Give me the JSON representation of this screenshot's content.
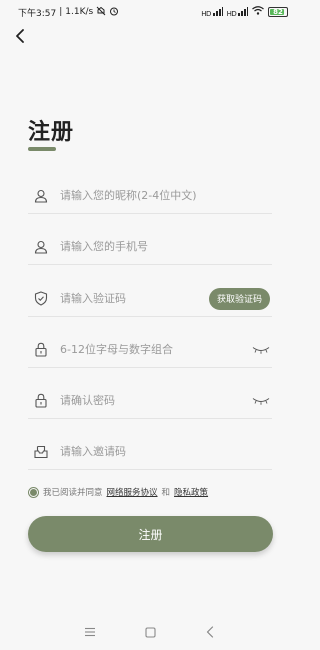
{
  "status_bar": {
    "time": "下午3:57",
    "speed": "1.1K/s",
    "signal1": "HD",
    "signal2": "HD",
    "battery": "82"
  },
  "page": {
    "title": "注册"
  },
  "fields": {
    "nickname": {
      "placeholder": "请输入您的昵称(2-4位中文)",
      "icon": "user-icon"
    },
    "phone": {
      "placeholder": "请输入您的手机号",
      "icon": "user-icon"
    },
    "code": {
      "placeholder": "请输入验证码",
      "icon": "shield-icon",
      "button_label": "获取验证码"
    },
    "password": {
      "placeholder": "6-12位字母与数字组合",
      "icon": "lock-icon"
    },
    "confirm_password": {
      "placeholder": "请确认密码",
      "icon": "lock-icon"
    },
    "invite_code": {
      "placeholder": "请输入邀请码",
      "icon": "inbox-icon"
    }
  },
  "agreement": {
    "prefix": "我已阅读并同意",
    "service_link": "网络服务协议",
    "and": "和",
    "privacy_link": "隐私政策"
  },
  "register_button": "注册",
  "colors": {
    "accent": "#7a8a6a",
    "background": "#f7f7f7"
  }
}
